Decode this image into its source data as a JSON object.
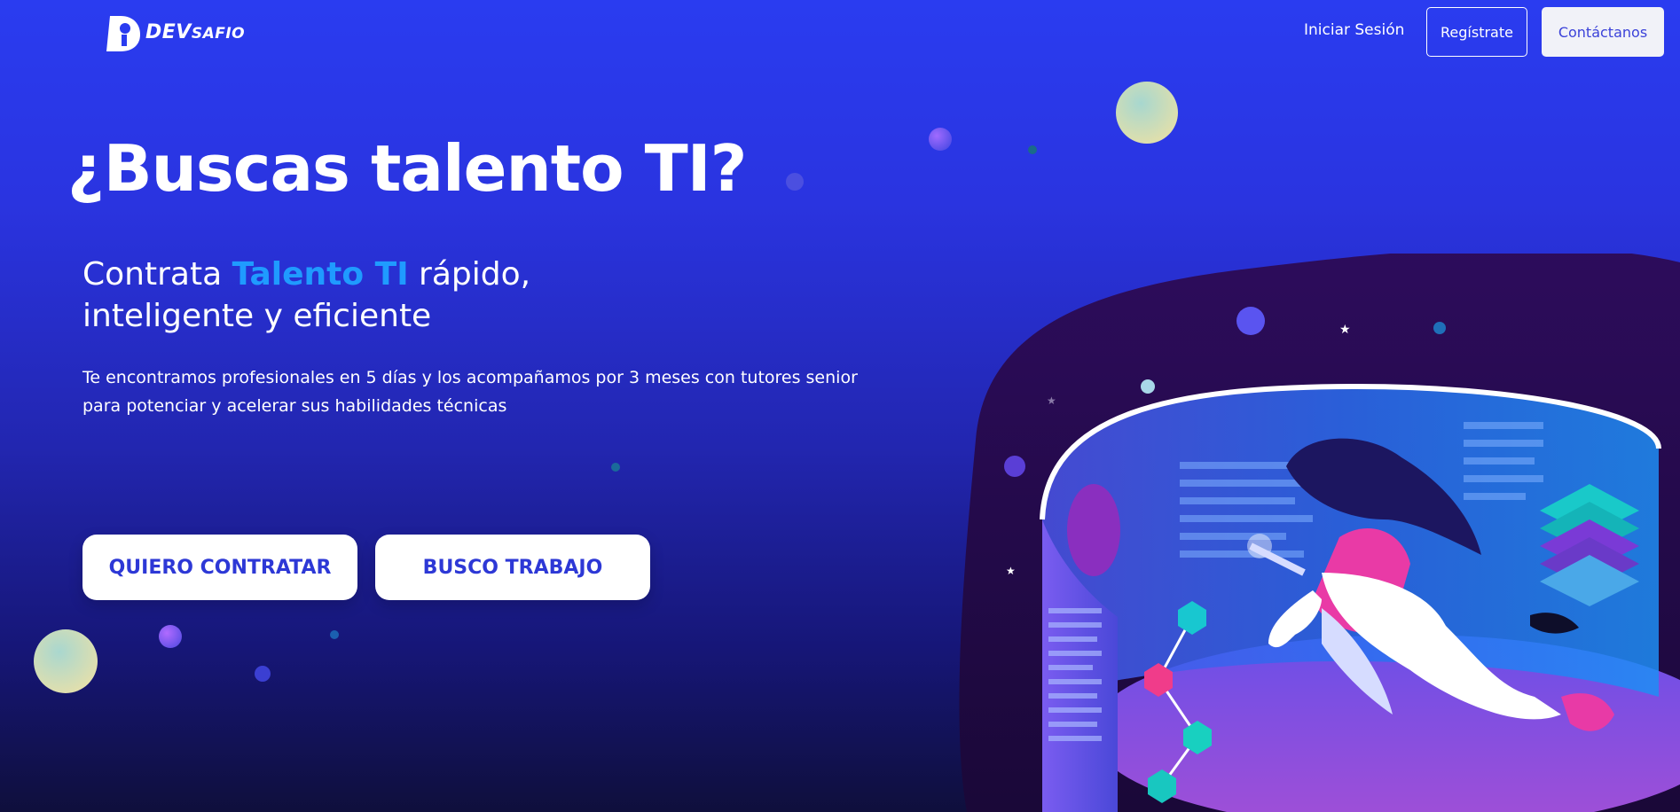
{
  "header": {
    "logo": {
      "icon": "devsafio-logo-icon",
      "text_main": "DEV",
      "text_small": "SAFIO"
    },
    "nav": {
      "login_label": "Iniciar Sesión",
      "register_label": "Regístrate",
      "contact_label": "Contáctanos"
    }
  },
  "hero": {
    "title": "¿Buscas talento TI?",
    "subtitle_prefix": "Contrata ",
    "subtitle_accent": "Talento TI",
    "subtitle_suffix_line1": " rápido,",
    "subtitle_line2": "inteligente y eficiente",
    "description": "Te encontramos profesionales en 5 días y los acompañamos por 3 meses con tutores senior para potenciar y acelerar sus habilidades técnicas",
    "cta_hire_label": "QUIERO CONTRATAR",
    "cta_job_label": "BUSCO TRABAJO"
  },
  "colors": {
    "background_top": "#2a3cf0",
    "background_bottom": "#0f0f3c",
    "accent": "#1f9bff",
    "button_text": "#2d38d6",
    "blob": "#2a0f58"
  },
  "illustration": {
    "icon": "woman-floating-in-data-cylinder-illustration"
  }
}
